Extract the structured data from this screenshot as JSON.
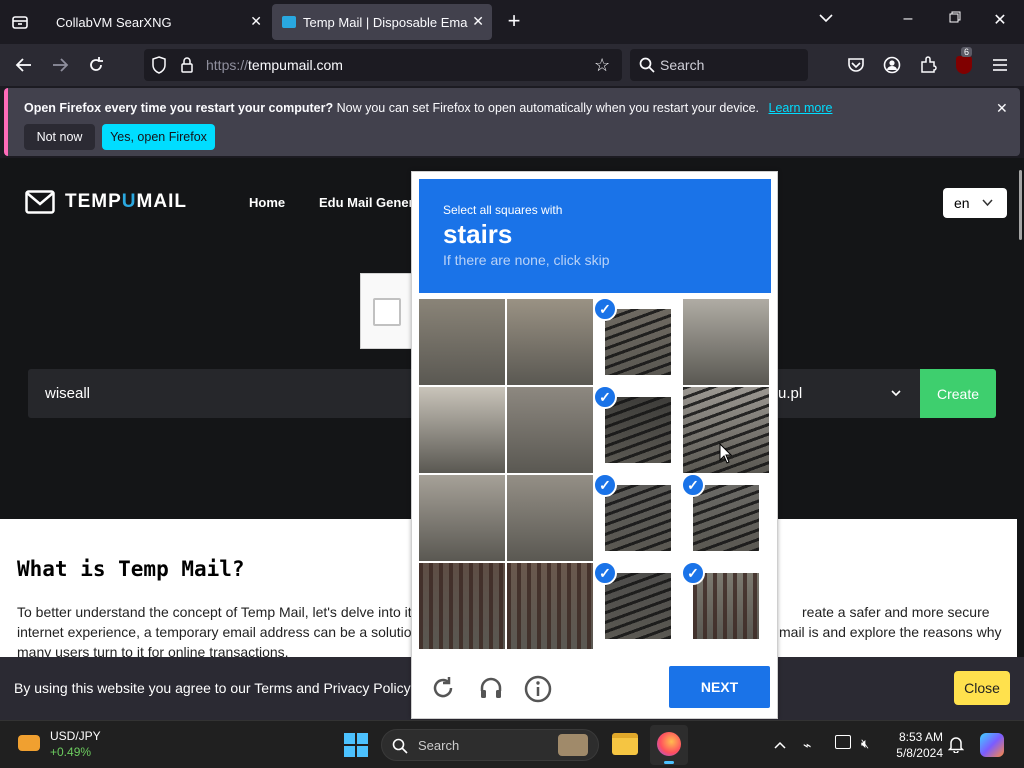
{
  "tabs": [
    {
      "title": "CollabVM SearXNG"
    },
    {
      "title": "Temp Mail | Disposable Email Address"
    }
  ],
  "navbar": {
    "url_scheme": "https://",
    "url_host": "tempumail.com",
    "search_placeholder": "Search",
    "extension_badge": "6"
  },
  "notification": {
    "bold": "Open Firefox every time you restart your computer?",
    "text": " Now you can set Firefox to open automatically when you restart your device.",
    "link": "Learn more",
    "not_now": "Not now",
    "yes": "Yes, open Firefox"
  },
  "site": {
    "logo_pre": "TEMP",
    "logo_u": "U",
    "logo_post": "MAIL",
    "nav": [
      "Home",
      "Edu Mail Genera"
    ],
    "lang": "en",
    "email_value": "wiseall",
    "domain_value": "u.pl",
    "create_label": "Create",
    "article_title": "What is Temp Mail?",
    "article_line1_left": "To better understand the concept of Temp Mail, let's delve into it",
    "article_line1_right": "reate a safer and more secure",
    "article_line2_left": "internet experience, a temporary email address can be a solutio",
    "article_line2_right": "mail is and explore the reasons why",
    "article_line3": "many users turn to it for online transactions.",
    "cookie_text": "By using this website you agree to our Terms and Privacy Policy",
    "cookie_close": "Close"
  },
  "captcha": {
    "instruction": "Select all squares with",
    "keyword": "stairs",
    "hint": "If there are none, click skip",
    "next_label": "NEXT",
    "selected_tiles": [
      2,
      6,
      10,
      11,
      14,
      15
    ]
  },
  "taskbar": {
    "ticker_name": "USD/JPY",
    "ticker_change": "+0.49%",
    "search_placeholder": "Search",
    "time": "8:53 AM",
    "date": "5/8/2024"
  },
  "colors": {
    "accent_blue": "#1a73e8",
    "create_green": "#3ecf6e",
    "firefox_yes": "#00ddff",
    "cookie_close": "#ffe14d"
  }
}
